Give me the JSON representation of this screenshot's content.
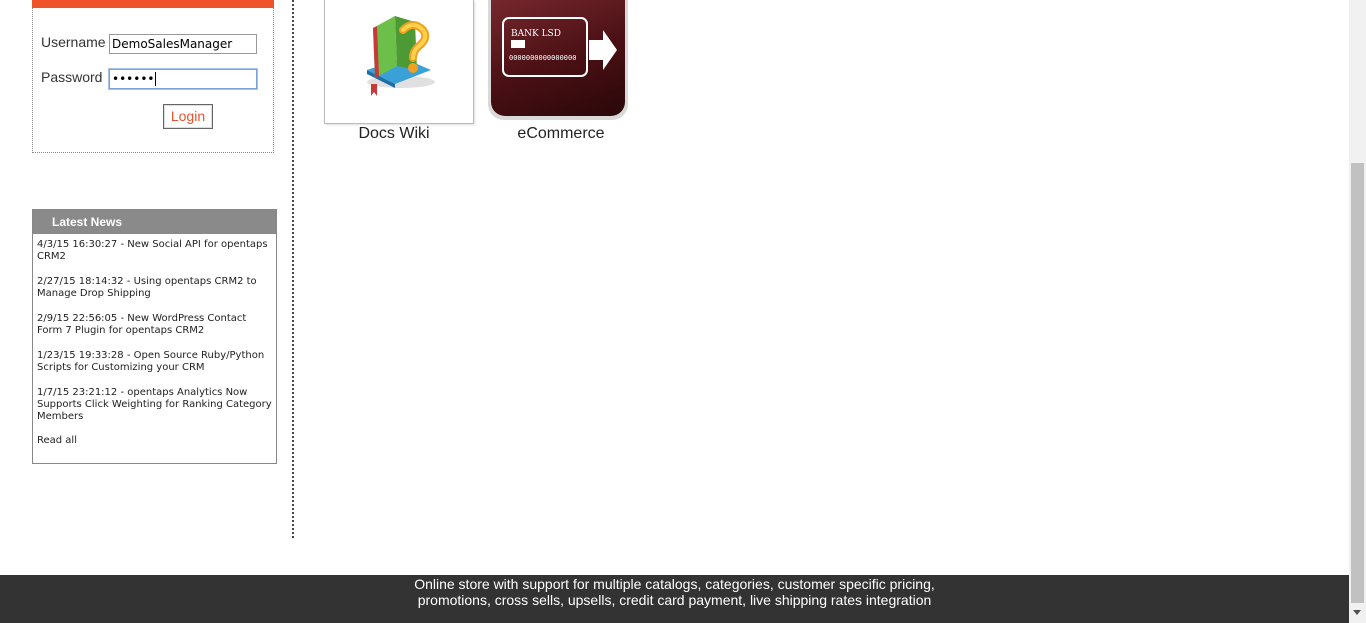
{
  "login": {
    "username_label": "Username",
    "username_value": "DemoSalesManager",
    "password_label": "Password",
    "password_value": "••••••",
    "login_label": "Login"
  },
  "news": {
    "title": "Latest News",
    "items": [
      "4/3/15 16:30:27 - New Social API for opentaps CRM2",
      "2/27/15 18:14:32 - Using opentaps CRM2 to Manage Drop Shipping",
      "2/9/15 22:56:05 - New WordPress Contact Form 7 Plugin for opentaps CRM2",
      "1/23/15 19:33:28 - Open Source Ruby/Python Scripts for Customizing your CRM",
      "1/7/15 23:21:12 - opentaps Analytics Now Supports Click Weighting for Ranking Category Members"
    ],
    "read_all": "Read all"
  },
  "apps": {
    "docs_label": "Docs Wiki",
    "ecommerce_label": "eCommerce",
    "card_bank_text": "BANK LSD",
    "card_number_text": "0000000000000000"
  },
  "footer": {
    "line1": "Online store with support for multiple catalogs, categories, customer specific pricing,",
    "line2": "promotions, cross sells, upsells, credit card payment, live shipping rates integration"
  },
  "colors": {
    "accent": "#f0532a",
    "footer_bg": "#333333",
    "news_header": "#8a8a8a"
  },
  "icons": [
    "help-book-icon",
    "credit-card-icon"
  ]
}
